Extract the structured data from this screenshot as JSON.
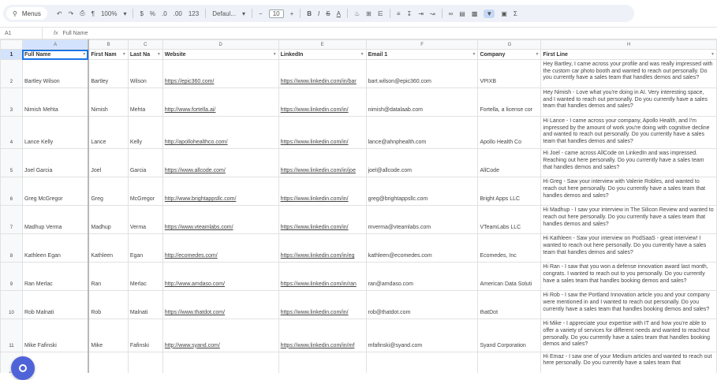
{
  "toolbar": {
    "menus_label": "Menus",
    "zoom": "100%",
    "currency": "$",
    "percent": "%",
    "decimal_dec": ".0",
    "decimal_inc": ".00",
    "number_format": "123",
    "font": "Defaul...",
    "font_size": "10",
    "bold": "B",
    "italic": "I",
    "strike": "S",
    "text_color": "A"
  },
  "formula_bar": {
    "cell_ref": "A1",
    "fx": "fx",
    "content": "Full Name"
  },
  "columns": [
    "A",
    "B",
    "C",
    "D",
    "E",
    "F",
    "G",
    "H"
  ],
  "header": [
    "Full Name",
    "First Nam",
    "Last Na",
    "Website",
    "LinkedIn",
    "Email 1",
    "Company",
    "First Line"
  ],
  "rows": [
    {
      "n": "2",
      "full": "Bartley Wilson",
      "first": "Bartley",
      "last": "Wilson",
      "web": "https://epic360.com/",
      "li": "https://www.linkedin.com/in/bar",
      "email": "bart.wilson@epic360.com",
      "company": "VPIXB",
      "line": "Hey Bartley, I came across your profile and was really impressed with the custom car photo booth and wanted to reach out personally. Do you currently have a sales team that handles demos and sales?"
    },
    {
      "n": "3",
      "full": "Nimish Mehta",
      "first": "Nimish",
      "last": "Mehta",
      "web": "http://www.fortella.ai/",
      "li": "https://www.linkedin.com/in/",
      "email": "nimish@datalaab.com",
      "company": "Fortella, a license cor",
      "line": "Hey Nimish - Love what you're doing in AI. Very interesting space, and I wanted to reach out personally. Do you currently have a sales team that handles demos and sales?"
    },
    {
      "n": "4",
      "full": "Lance Kelly",
      "first": "Lance",
      "last": "Kelly",
      "web": "http://apollohealthco.com/",
      "li": "https://www.linkedin.com/in/",
      "email": "lance@ahnphealth.com",
      "company": "Apollo Health Co",
      "line": "Hi Lance - I came across your company, Apollo Health, and I'm impressed by the amount of work you're doing with cognitive decline and wanted to reach out personally. Do you currently have a sales team that handles demos and sales?"
    },
    {
      "n": "5",
      "full": "Joel Garcia",
      "first": "Joel",
      "last": "Garcia",
      "web": "https://www.allcode.com/",
      "li": "https://www.linkedin.com/in/joe",
      "email": "joel@allcode.com",
      "company": "AllCode",
      "line": "Hi Joel - came across AllCode on LinkedIn and was impressed. Reaching out here personally. Do you currently have a sales team that handles demos and sales?"
    },
    {
      "n": "6",
      "full": "Greg McGregor",
      "first": "Greg",
      "last": "McGregor",
      "web": "http://www.brightappsllc.com/",
      "li": "https://www.linkedin.com/in/",
      "email": "greg@brightappsllc.com",
      "company": "Bright Apps LLC",
      "line": "Hi Greg - Saw your interview with Valerie Robles, and wanted to reach out here personally. Do you currently have a sales team that handles demos and sales?"
    },
    {
      "n": "7",
      "full": "Madhup Verma",
      "first": "Madhup",
      "last": "Verma",
      "web": "https://www.vteamlabs.com/",
      "li": "https://www.linkedin.com/in/",
      "email": "mverma@vteamlabs.com",
      "company": "VTeamLabs LLC",
      "line": "Hi Madhup - I saw your interview in The Silicon Review and wanted to reach out here personally. Do you currently have a sales team that handles demos and sales?"
    },
    {
      "n": "8",
      "full": "Kathleen Egan",
      "first": "Kathleen",
      "last": "Egan",
      "web": "http://ecomedes.com/",
      "li": "https://www.linkedin.com/in/eg",
      "email": "kathleen@ecomedes.com",
      "company": "Ecomedes, Inc",
      "line": "Hi Kathleen - Saw your interview on PodSaaS - great interview! I wanted to reach out here personally. Do you currently have a sales team that handles demos and sales?"
    },
    {
      "n": "9",
      "full": "Ran Merlac",
      "first": "Ran",
      "last": "Merlac",
      "web": "http://www.amdaso.com/",
      "li": "https://www.linkedin.com/in/ran",
      "email": "ran@amdaso.com",
      "company": "American Data Soluti",
      "line": "Hi Ran - I saw that you won a defense innovation award last month, congrats. I wanted to reach out to you personally. Do you currently have a sales team that handles booking demos and sales?"
    },
    {
      "n": "10",
      "full": "Rob Malnati",
      "first": "Rob",
      "last": "Malnati",
      "web": "https://www.thatdot.com/",
      "li": "https://www.linkedin.com/in/",
      "email": "rob@thatdot.com",
      "company": "thatDot",
      "line": "Hi Rob - I saw the Portland Innovation article you and your company were mentioned in and I wanted to reach out personally. Do you currently have a sales team that handles booking demos and sales?"
    },
    {
      "n": "11",
      "full": "Mike Fafinski",
      "first": "Mike",
      "last": "Fafinski",
      "web": "http://www.syand.com/",
      "li": "https://www.linkedin.com/in/mf",
      "email": "mfafinski@syand.com",
      "company": "Syand Corporation",
      "line": "Hi Mike - I appreciate your expertise with IT and how you're able to offer a variety of services for different needs and wanted to reachout personally. Do you currently have a sales team that handles booking demos and sales?"
    },
    {
      "n": "12",
      "full": "",
      "first": "",
      "last": "",
      "web": "",
      "li": "",
      "email": "",
      "company": "",
      "line": "Hi Emaz - I saw one of your Medium articles and wanted to reach out here personally. Do you currently have a sales team that"
    }
  ]
}
